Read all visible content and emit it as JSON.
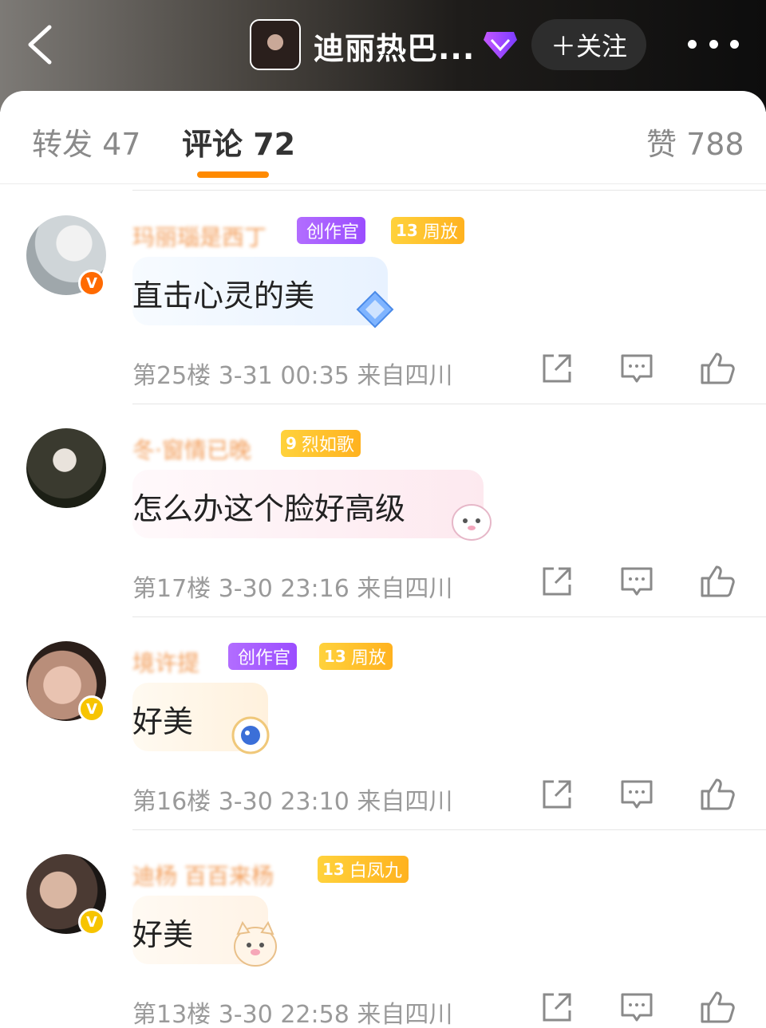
{
  "header": {
    "title": "迪丽热巴...",
    "follow_label": "＋关注",
    "back_icon": "back-chevron-icon",
    "more_icon": "more-dots-icon"
  },
  "tabs": {
    "reposts": "转发 47",
    "comments": "评论 72",
    "likes": "赞 788"
  },
  "comments": [
    {
      "username": "玛丽瑙是西丁",
      "badges": [
        {
          "type": "purple",
          "num": "",
          "text": "创作官"
        },
        {
          "type": "yellow",
          "num": "13",
          "text": "周放"
        }
      ],
      "text": "直击心灵的美",
      "meta": "第25楼  3-31 00:35  来自四川",
      "verified": "orange"
    },
    {
      "username": "冬·窗情已晚",
      "badges": [
        {
          "type": "yellow",
          "num": "9",
          "text": "烈如歌"
        }
      ],
      "text": "怎么办这个脸好高级",
      "meta": "第17楼  3-30 23:16  来自四川",
      "verified": "none"
    },
    {
      "username": "境许提",
      "badges": [
        {
          "type": "purple",
          "num": "",
          "text": "创作官"
        },
        {
          "type": "yellow",
          "num": "13",
          "text": "周放"
        }
      ],
      "text": "好美",
      "meta": "第16楼  3-30 23:10  来自四川",
      "verified": "gold"
    },
    {
      "username": "迪杨 百百来杨",
      "badges": [
        {
          "type": "yellow",
          "num": "13",
          "text": "白凤九"
        }
      ],
      "text": "好美",
      "meta": "第13楼  3-30 22:58  来自四川",
      "verified": "gold"
    }
  ],
  "colors": {
    "accent": "#ff8a00",
    "badge_purple": "#9b4dff",
    "badge_yellow": "#ffb21f",
    "verified_orange": "#ff6a00",
    "verified_gold": "#f7c400"
  }
}
